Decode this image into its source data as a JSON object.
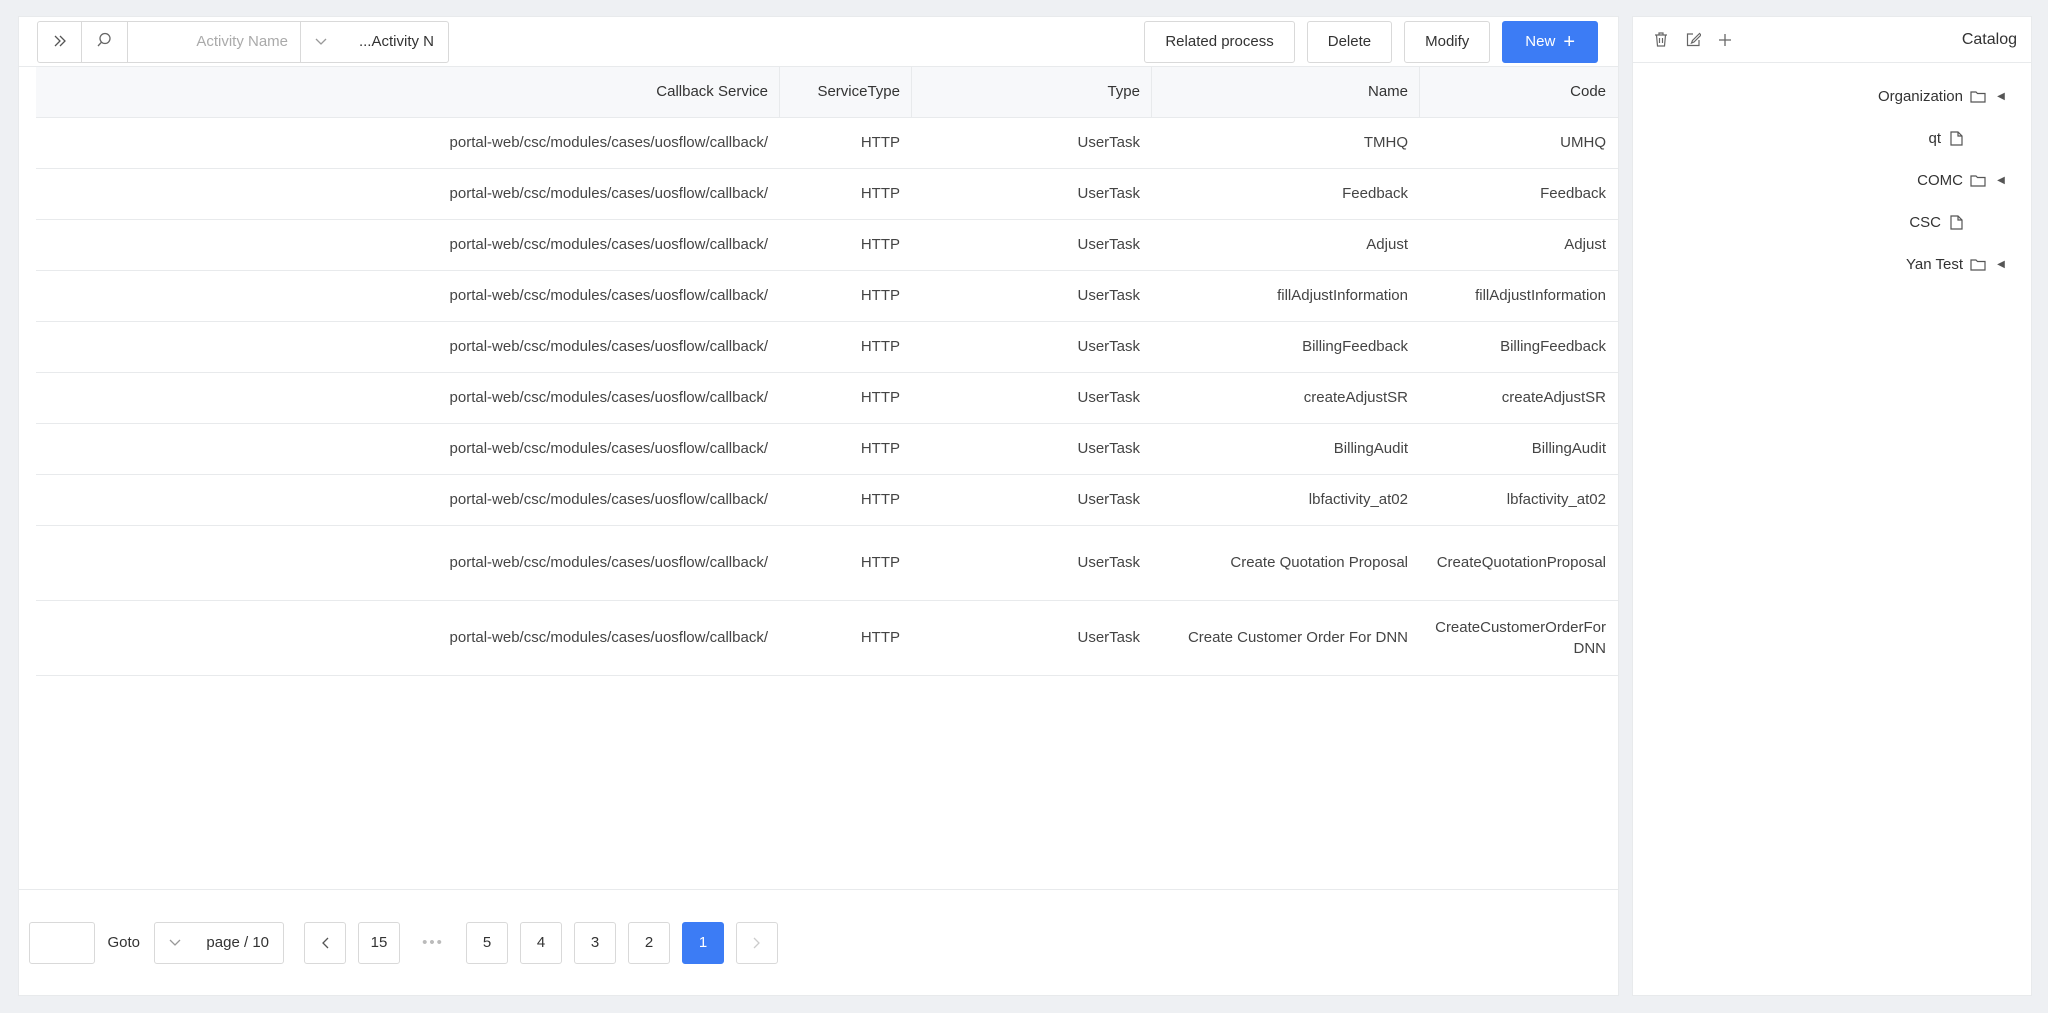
{
  "catalog": {
    "title": "Catalog",
    "tree": [
      {
        "label": "Organization",
        "kind": "folder",
        "level": 0,
        "expandable": true
      },
      {
        "label": "qt",
        "kind": "file",
        "level": 1,
        "expandable": false
      },
      {
        "label": "COMC",
        "kind": "folder",
        "level": 0,
        "expandable": true
      },
      {
        "label": "CSC",
        "kind": "file",
        "level": 1,
        "expandable": false
      },
      {
        "label": "Yan Test",
        "kind": "folder",
        "level": 0,
        "expandable": true
      }
    ]
  },
  "toolbar": {
    "new_label": "New",
    "modify_label": "Modify",
    "delete_label": "Delete",
    "related_label": "Related process",
    "search_field_value": "Activity N...",
    "search_placeholder": "Activity Name"
  },
  "table": {
    "columns": [
      "Code",
      "Name",
      "Type",
      "ServiceType",
      "Callback Service"
    ],
    "rows": [
      [
        "UMHQ",
        "TMHQ",
        "UserTask",
        "HTTP",
        "/portal-web/csc/modules/cases/uosflow/callback"
      ],
      [
        "Feedback",
        "Feedback",
        "UserTask",
        "HTTP",
        "/portal-web/csc/modules/cases/uosflow/callback"
      ],
      [
        "Adjust",
        "Adjust",
        "UserTask",
        "HTTP",
        "/portal-web/csc/modules/cases/uosflow/callback"
      ],
      [
        "fillAdjustInformation",
        "fillAdjustInformation",
        "UserTask",
        "HTTP",
        "/portal-web/csc/modules/cases/uosflow/callback"
      ],
      [
        "BillingFeedback",
        "BillingFeedback",
        "UserTask",
        "HTTP",
        "/portal-web/csc/modules/cases/uosflow/callback"
      ],
      [
        "createAdjustSR",
        "createAdjustSR",
        "UserTask",
        "HTTP",
        "/portal-web/csc/modules/cases/uosflow/callback"
      ],
      [
        "BillingAudit",
        "BillingAudit",
        "UserTask",
        "HTTP",
        "/portal-web/csc/modules/cases/uosflow/callback"
      ],
      [
        "lbfactivity_at02",
        "lbfactivity_at02",
        "UserTask",
        "HTTP",
        "/portal-web/csc/modules/cases/uosflow/callback"
      ],
      [
        "CreateQuotationProposal",
        "Create Quotation Proposal",
        "UserTask",
        "HTTP",
        "/portal-web/csc/modules/cases/uosflow/callback"
      ],
      [
        "CreateCustomerOrderForDNN",
        "Create Customer Order For DNN",
        "UserTask",
        "HTTP",
        "/portal-web/csc/modules/cases/uosflow/callback"
      ]
    ]
  },
  "pagination": {
    "pages": [
      "1",
      "2",
      "3",
      "4",
      "5",
      "•••",
      "15"
    ],
    "current": "1",
    "page_size": "10 / page",
    "goto_label": "Goto"
  },
  "colors": {
    "primary": "#3c7cf5"
  }
}
